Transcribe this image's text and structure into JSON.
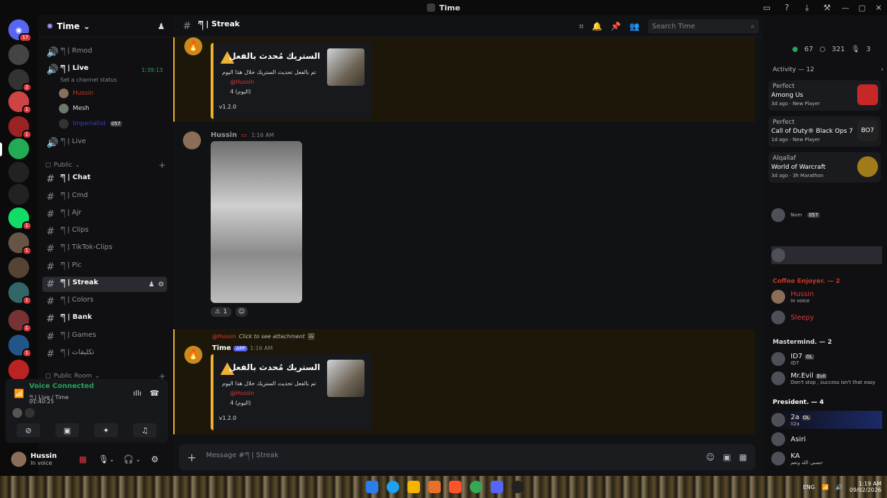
{
  "titlebar": {
    "title": "Time"
  },
  "servers": {
    "badges": [
      "17",
      "2",
      "1",
      "1",
      "1",
      "1",
      "1",
      "1",
      "1"
    ]
  },
  "guild": {
    "name": "Time"
  },
  "channels": {
    "voice_top": [
      {
        "label": "ཀ | Rmod"
      },
      {
        "label": "ཀ | Live",
        "timer": "1:39:13",
        "status": "Set a channel status"
      }
    ],
    "voice_users": [
      {
        "name": "Hussin"
      },
      {
        "name": "Mesh"
      },
      {
        "name": "Imperialist",
        "tag": "057"
      }
    ],
    "voice_live2": "ཀ | Live",
    "public_label": "Public",
    "text": [
      "ཀ | Chat",
      "ཀ | Cmd",
      "ཀ | Ajr",
      "ཀ | Clips",
      "ཀ | TikTok-Clips",
      "ཀ | Pic",
      "ཀ | Streak",
      "ཀ | Colors",
      "ཀ | Bank",
      "ཀ | Games",
      "ཀ | تكليفات"
    ],
    "public_room_label": "Public Room"
  },
  "voice_panel": {
    "title": "Voice Connected",
    "sub": "ཀ | Live / Time",
    "time": "01:40:25"
  },
  "user": {
    "name": "Hussin",
    "status": "In voice"
  },
  "channel_header": {
    "name": "ཀ | Streak",
    "search_placeholder": "Search Time"
  },
  "messages": {
    "embed_title": "الستريك مُحدث بالفعل",
    "embed_line1": "تم بالفعل تحديث الستريك خلال هذا اليوم",
    "embed_user": "@Hussin",
    "embed_streak": "4 (اليوم)",
    "embed_version": "v1.2.0",
    "msg2_author": "Hussin",
    "msg2_time": "1:16 AM",
    "reaction_count": "1",
    "reply_user": "@Hussin",
    "reply_text": "Click to see attachment",
    "msg3_author": "Time",
    "msg3_badge": "APP",
    "msg3_time": "1:16 AM"
  },
  "composer": {
    "placeholder": "Message #ཀ | Streak"
  },
  "members": {
    "online": "67",
    "members": "321",
    "voice": "3",
    "activity_label": "Activity — 12",
    "activities": [
      {
        "user": "Perfect",
        "game": "Among Us",
        "meta": "3d ago · New Player"
      },
      {
        "user": "Perfect",
        "game": "Call of Duty® Black Ops 7",
        "meta": "1d ago · New Player"
      },
      {
        "user": "Alqallaf",
        "game": "World of Warcraft",
        "meta": "3d ago · 3h Marathon"
      }
    ],
    "groups": [
      {
        "label": "Coffee Enjoyer. — 2",
        "color": "#c0392b"
      },
      {
        "label": "Mastermind. — 2",
        "color": "#dbdee1"
      },
      {
        "label": "President. — 4",
        "color": "#ffffff"
      }
    ],
    "list": [
      {
        "name": "Hussin",
        "status": "In voice"
      },
      {
        "name": "Sleepy",
        "status": ""
      },
      {
        "name": "ID7",
        "tag": "OL",
        "status": "ID7"
      },
      {
        "name": "Mr.Evil",
        "tag": "Evil",
        "status": "Don't stop , success isn't that easy"
      },
      {
        "name": "2a",
        "tag": "OL",
        "status": "li2a"
      },
      {
        "name": "Asiri",
        "status": ""
      },
      {
        "name": "KA",
        "status": "حسبي الله ونعم"
      }
    ],
    "extra": [
      {
        "name": "Nvm",
        "tag": "057"
      }
    ]
  },
  "taskbar": {
    "lang": "ENG",
    "time": "1:19 AM",
    "date": "09/02/2026"
  }
}
